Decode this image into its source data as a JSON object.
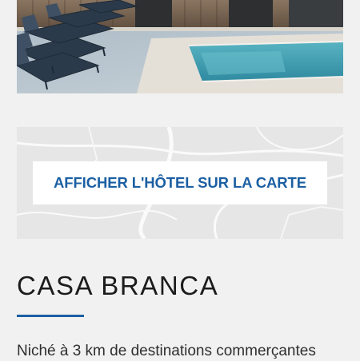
{
  "hero": {
    "image_alt": "Piscine et transats de l'hôtel",
    "colors": {
      "water": "#4aa3b4",
      "deck": "#dedad2",
      "wood": "#6d5a48",
      "loungers": "#2b3a4b"
    }
  },
  "map": {
    "button_label": "AFFICHER L'HÔTEL SUR LA CARTE",
    "colors": {
      "background": "#e6e6e6",
      "roads": "#ffffff",
      "button_text": "#1b5fa3"
    }
  },
  "hotel": {
    "name": "CASA BRANCA",
    "description": "Niché à 3 km de destinations commerçantes",
    "accent_color": "#1b5fa3"
  }
}
